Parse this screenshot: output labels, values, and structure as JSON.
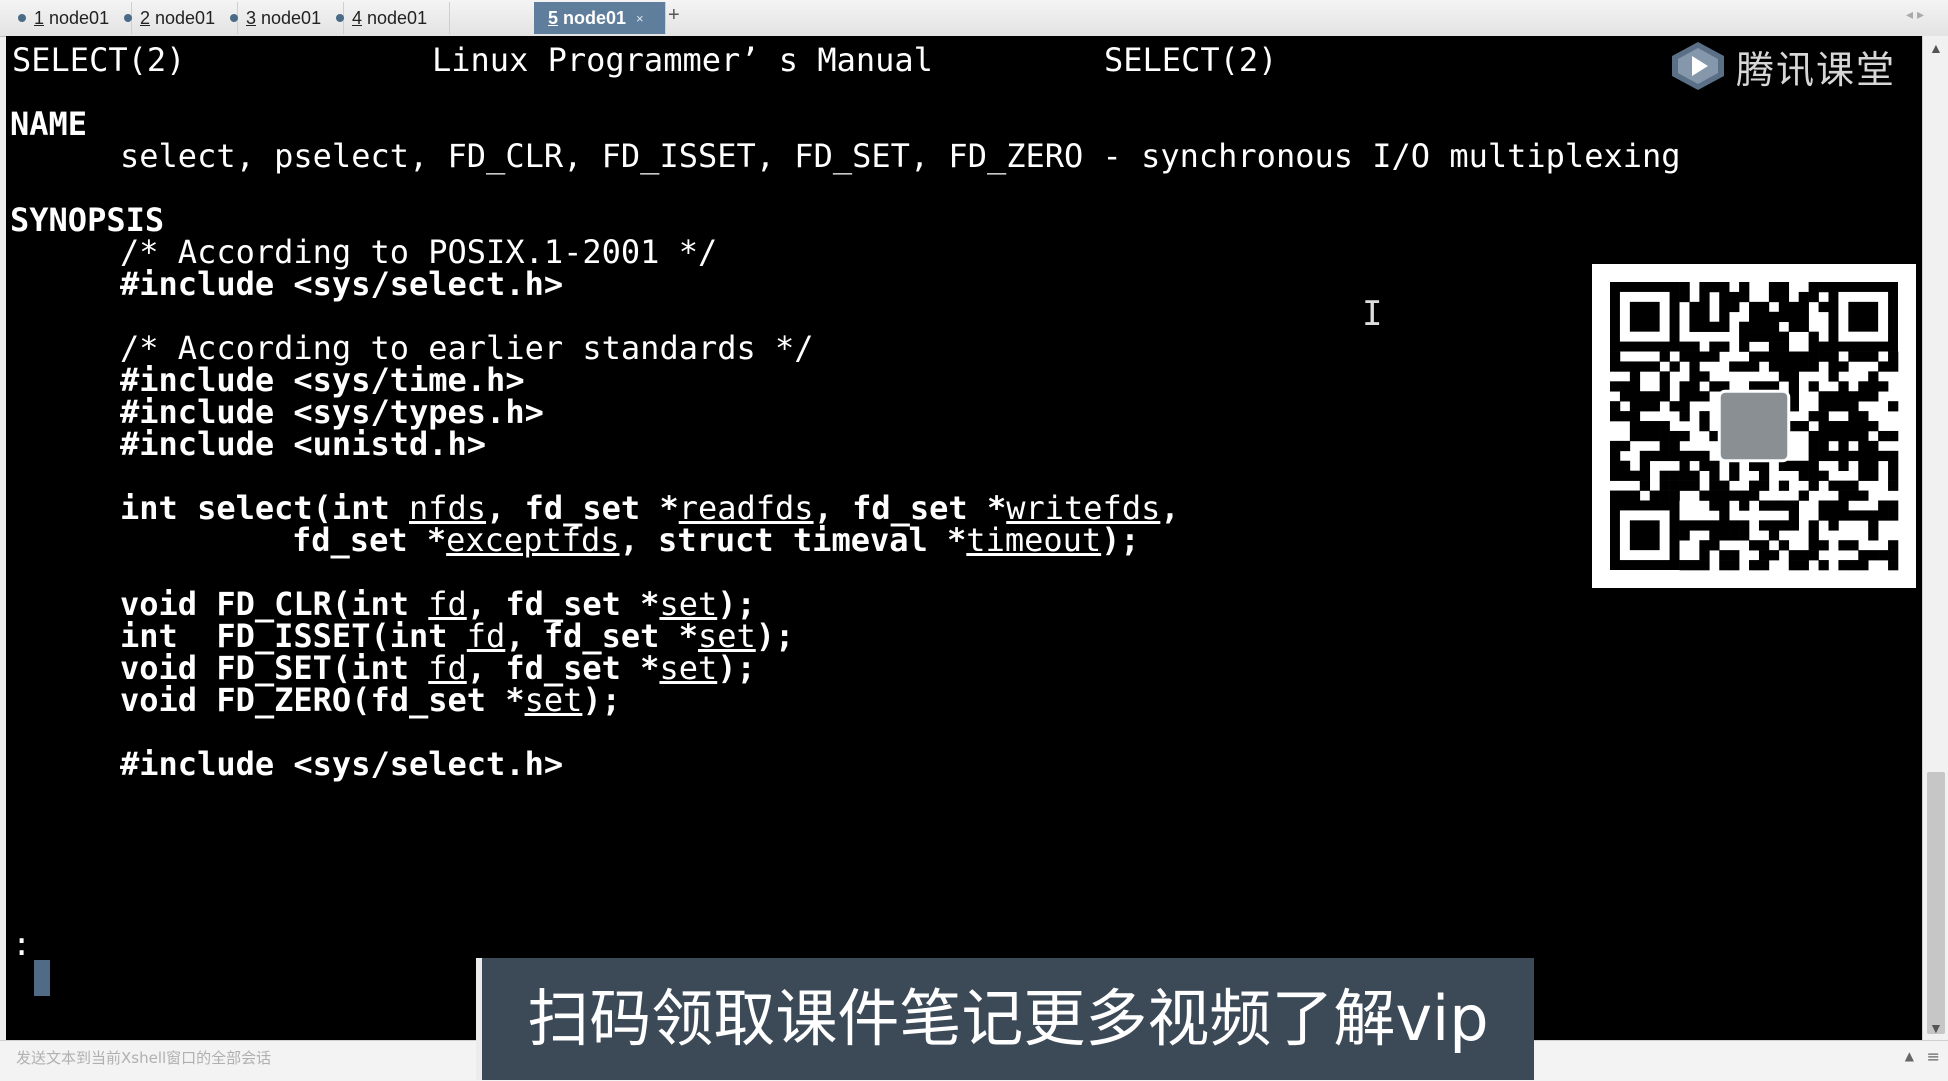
{
  "tabs": [
    {
      "num": "1",
      "label": "node01",
      "active": false
    },
    {
      "num": "2",
      "label": "node01",
      "active": false
    },
    {
      "num": "3",
      "label": "node01",
      "active": false
    },
    {
      "num": "4",
      "label": "node01",
      "active": false
    },
    {
      "num": "5",
      "label": "node01",
      "active": true,
      "close": "×"
    }
  ],
  "tab_add": "+",
  "header": {
    "left": "SELECT(2)",
    "center": "Linux Programmer’ s Manual",
    "right": "SELECT(2)"
  },
  "name_section": {
    "heading": "NAME",
    "description": "select, pselect, FD_CLR, FD_ISSET, FD_SET, FD_ZERO - synchronous I/O multiplexing"
  },
  "synopsis": {
    "heading": "SYNOPSIS",
    "comment_posix": "/* According to POSIX.1-2001 */",
    "include_select": "#include <sys/select.h>",
    "comment_earlier": "/* According to earlier standards */",
    "include_time": "#include <sys/time.h>",
    "include_types": "#include <sys/types.h>",
    "include_unistd": "#include <unistd.h>",
    "select_sig": {
      "ret": "int select(int ",
      "nfds": "nfds",
      "p2": ", fd_set *",
      "readfds": "readfds",
      "p3": ", fd_set *",
      "writefds": "writefds",
      "p4": ",",
      "p5": "fd_set *",
      "exceptfds": "exceptfds",
      "p6": ", struct timeval *",
      "timeout": "timeout",
      "p7": ");"
    },
    "fd_clr": {
      "pre": "void FD_CLR(int ",
      "fd": "fd",
      "mid": ", fd_set *",
      "set": "set",
      "end": ");"
    },
    "fd_isset": {
      "pre": "int  FD_ISSET(int ",
      "fd": "fd",
      "mid": ", fd_set *",
      "set": "set",
      "end": ");"
    },
    "fd_set": {
      "pre": "void FD_SET(int ",
      "fd": "fd",
      "mid": ", fd_set *",
      "set": "set",
      "end": ");"
    },
    "fd_zero": {
      "pre": "void FD_ZERO(fd_set *",
      "set": "set",
      "end": ");"
    },
    "include_select_2": "#include <sys/select.h>"
  },
  "prompt": ":",
  "ibeam": "I",
  "logo_text": "腾讯课堂",
  "caption": "扫码领取课件笔记更多视频了解vip",
  "statusbar": {
    "text": "发送文本到当前Xshell窗口的全部会话",
    "arrow": "▲",
    "menu": "≡"
  },
  "scrollbar": {
    "up": "▲",
    "down": "▼",
    "position": 0.85
  },
  "colors": {
    "terminal_bg": "#000000",
    "terminal_fg": "#ffffff",
    "active_tab": "#5e7e9c",
    "caption_bg": "#3c4a58"
  },
  "icons": {
    "logo": "tencent-classroom-play-icon",
    "qr": "qr-code"
  }
}
